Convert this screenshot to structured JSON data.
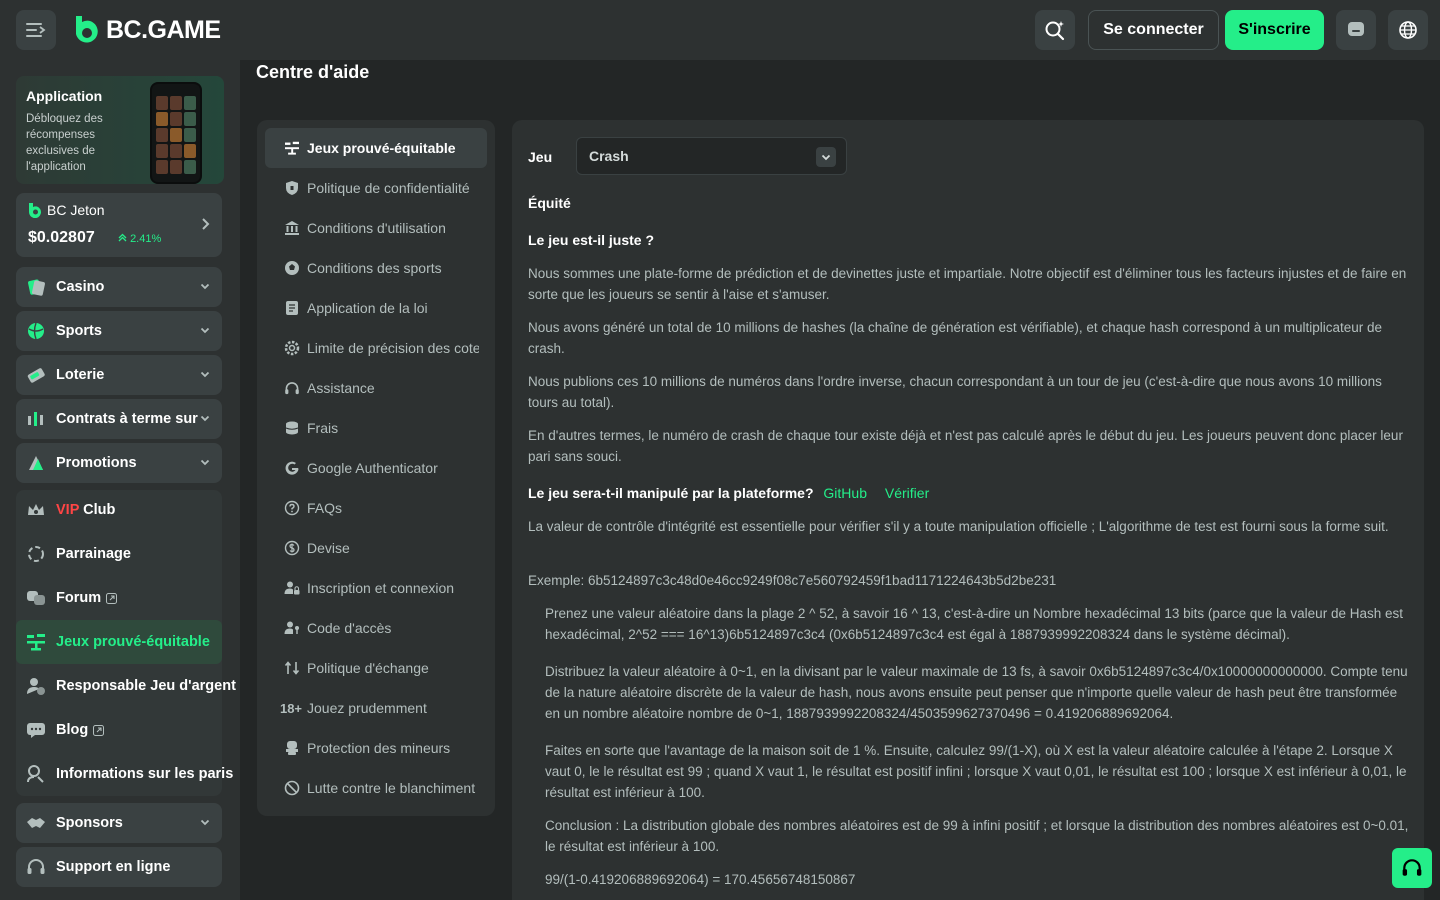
{
  "header": {
    "logo_text": "BC.GAME",
    "login_label": "Se connecter",
    "signup_label": "S'inscrire"
  },
  "sidebar": {
    "app_card": {
      "title": "Application",
      "description": "Débloquez des récompenses exclusives de l'application"
    },
    "jeton": {
      "name": "BC Jeton",
      "price": "$0.02807",
      "change": "2.41%"
    },
    "items": [
      {
        "label": "Casino",
        "icon": "casino-icon",
        "expandable": true
      },
      {
        "label": "Sports",
        "icon": "sports-icon",
        "expandable": true
      },
      {
        "label": "Loterie",
        "icon": "lottery-icon",
        "expandable": true
      },
      {
        "label": "Contrats à terme sur",
        "icon": "futures-icon",
        "expandable": true
      },
      {
        "label": "Promotions",
        "icon": "promotions-icon",
        "expandable": true
      }
    ],
    "vip_prefix": "VIP",
    "vip_suffix": " Club",
    "sub_items": [
      {
        "label": "Parrainage",
        "icon": "referral-icon"
      },
      {
        "label": "Forum",
        "icon": "forum-icon",
        "external": true
      },
      {
        "label": "Jeux prouvé-équitable",
        "icon": "provably-fair-icon",
        "active": true
      },
      {
        "label": "Responsable Jeu d'argent",
        "icon": "responsible-gambling-icon"
      },
      {
        "label": "Blog",
        "icon": "blog-icon",
        "external": true
      },
      {
        "label": "Informations sur les paris",
        "icon": "betting-info-icon"
      }
    ],
    "sponsors_label": "Sponsors",
    "support_label": "Support en ligne"
  },
  "page": {
    "title": "Centre d'aide"
  },
  "topics": [
    {
      "label": "Jeux prouvé-équitable",
      "icon": "provably-fair-icon",
      "active": true
    },
    {
      "label": "Politique de confidentialité",
      "icon": "shield-icon"
    },
    {
      "label": "Conditions d'utilisation",
      "icon": "bank-icon"
    },
    {
      "label": "Conditions des sports",
      "icon": "soccer-ball-icon"
    },
    {
      "label": "Application de la loi",
      "icon": "document-icon"
    },
    {
      "label": "Limite de précision des cotes",
      "icon": "gear-icon"
    },
    {
      "label": "Assistance",
      "icon": "headset-icon"
    },
    {
      "label": "Frais",
      "icon": "coins-icon"
    },
    {
      "label": "Google Authenticator",
      "icon": "google-icon"
    },
    {
      "label": "FAQs",
      "icon": "question-icon"
    },
    {
      "label": "Devise",
      "icon": "dollar-icon"
    },
    {
      "label": "Inscription et connexion",
      "icon": "user-lock-icon"
    },
    {
      "label": "Code d'accès",
      "icon": "user-key-icon"
    },
    {
      "label": "Politique d'échange",
      "icon": "exchange-icon"
    },
    {
      "label": "Jouez prudemment",
      "icon": "age-18-icon",
      "icon_text": "18+"
    },
    {
      "label": "Protection des mineurs",
      "icon": "protection-icon"
    },
    {
      "label": "Lutte contre le blanchiment",
      "icon": "ban-icon"
    }
  ],
  "content": {
    "game_label": "Jeu",
    "game_value": "Crash",
    "heading_fairness": "Équité",
    "question1": "Le jeu est-il juste ?",
    "para1": "Nous sommes une plate-forme de prédiction et de devinettes juste et impartiale. Notre objectif est d'éliminer tous les facteurs injustes et de faire en sorte que les joueurs se sentir à l'aise et s'amuser.",
    "para2": "Nous avons généré un total de 10 millions de hashes (la chaîne de génération est vérifiable), et chaque hash correspond à un multiplicateur de crash.",
    "para3": "Nous publions ces 10 millions de numéros dans l'ordre inverse, chacun correspondant à un tour de jeu (c'est-à-dire que nous avons 10 millions tours au total).",
    "para4": "En d'autres termes, le numéro de crash de chaque tour existe déjà et n'est pas calculé après le début du jeu. Les joueurs peuvent donc placer leur pari sans souci.",
    "question2": "Le jeu sera-t-il manipulé par la plateforme?",
    "github_link": "GitHub",
    "verify_link": "Vérifier",
    "para5": "La valeur de contrôle d'intégrité est essentielle pour vérifier s'il y a toute manipulation officielle ; L'algorithme de test est fourni sous la forme suit.",
    "example": "Exemple: 6b5124897c3c48d0e46cc9249f08c7e560792459f1bad1171224643b5d2be231",
    "step1": "Prenez une valeur aléatoire dans la plage 2 ^ 52, à savoir 16 ^ 13, c'est-à-dire un Nombre hexadécimal 13 bits (parce que la valeur de Hash est hexadécimal, 2^52 === 16^13)6b5124897c3c4 (0x6b5124897c3c4 est égal à 1887939992208324 dans le système décimal).",
    "step2": "Distribuez la valeur aléatoire à 0~1, en la divisant par le valeur maximale de 13 fs, à savoir 0x6b5124897c3c4/0x10000000000000. Compte tenu de la nature aléatoire discrète de la valeur de hash, nous avons ensuite peut penser que n'importe quelle valeur de hash peut être transformée en un nombre aléatoire nombre de 0~1, 1887939992208324/4503599627370496 = 0.419206889692064.",
    "step3": "Faites en sorte que l'avantage de la maison soit de 1 %. Ensuite, calculez 99/(1-X), où X est la valeur aléatoire calculée à l'étape 2. Lorsque X vaut 0, le le résultat est 99 ; quand X vaut 1, le résultat est positif infini ; lorsque X vaut 0,01, le résultat est 100 ; lorsque X est inférieur à 0,01, le résultat est inférieur à 100.",
    "conclusion": "Conclusion : La distribution globale des nombres aléatoires est de 99 à infini positif ; et lorsque la distribution des nombres aléatoires est 0~0.01, le résultat est inférieur à 100.",
    "formula": "99/(1-0.419206889692064) = 170.45656748150867"
  },
  "colors": {
    "accent": "#24ee89",
    "background": "#232626",
    "panel": "#2d3131"
  }
}
